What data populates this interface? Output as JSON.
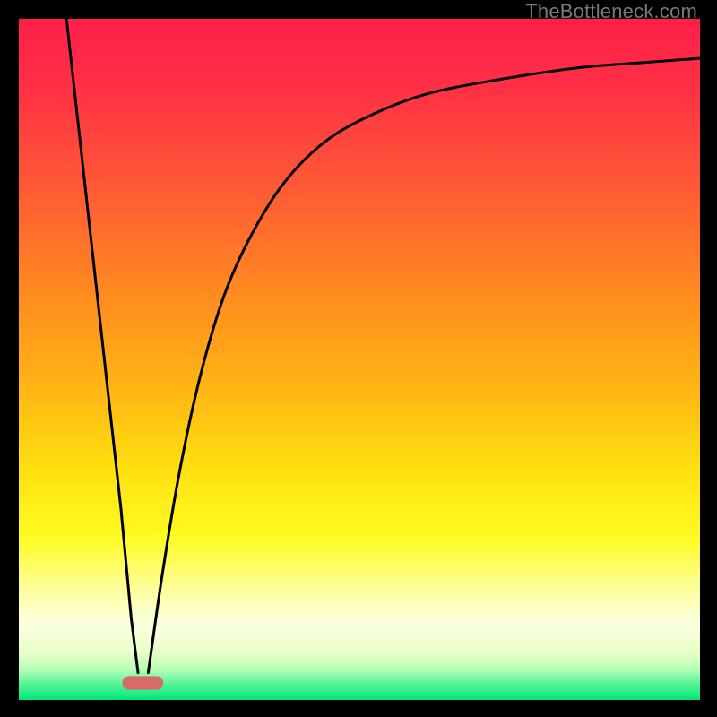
{
  "watermark": {
    "text": "TheBottleneck.com"
  },
  "gradient": {
    "stops": [
      {
        "offset": 0.0,
        "color": "#ff1f4b"
      },
      {
        "offset": 0.1,
        "color": "#ff3045"
      },
      {
        "offset": 0.25,
        "color": "#ff5a35"
      },
      {
        "offset": 0.4,
        "color": "#ff8a20"
      },
      {
        "offset": 0.55,
        "color": "#ffb814"
      },
      {
        "offset": 0.66,
        "color": "#ffe010"
      },
      {
        "offset": 0.76,
        "color": "#fffb22"
      },
      {
        "offset": 0.84,
        "color": "#fdffa0"
      },
      {
        "offset": 0.89,
        "color": "#faffe0"
      },
      {
        "offset": 0.93,
        "color": "#e8ffc6"
      },
      {
        "offset": 0.955,
        "color": "#b6ffb8"
      },
      {
        "offset": 0.975,
        "color": "#5cf598"
      },
      {
        "offset": 1.0,
        "color": "#00e77a"
      }
    ]
  },
  "marker": {
    "cx_frac": 0.182,
    "cy_frac": 0.975,
    "w_frac": 0.06,
    "h_frac": 0.02,
    "fill": "#d96a6a"
  },
  "chart_data": {
    "type": "line",
    "title": "",
    "xlabel": "",
    "ylabel": "",
    "xlim": [
      0,
      1
    ],
    "ylim": [
      0,
      1
    ],
    "legend": false,
    "grid": false,
    "series": [
      {
        "name": "left-branch",
        "x": [
          0.07,
          0.09,
          0.11,
          0.13,
          0.15,
          0.165,
          0.175
        ],
        "values": [
          1.0,
          0.82,
          0.64,
          0.46,
          0.28,
          0.12,
          0.04
        ]
      },
      {
        "name": "right-branch",
        "x": [
          0.19,
          0.21,
          0.235,
          0.265,
          0.3,
          0.34,
          0.39,
          0.45,
          0.52,
          0.6,
          0.7,
          0.82,
          0.92,
          1.0
        ],
        "values": [
          0.04,
          0.18,
          0.33,
          0.47,
          0.59,
          0.68,
          0.76,
          0.82,
          0.86,
          0.89,
          0.91,
          0.928,
          0.936,
          0.942
        ]
      }
    ],
    "annotations": [
      {
        "type": "marker",
        "shape": "pill",
        "x": 0.182,
        "y": 0.025,
        "label": "minimum",
        "color": "#d96a6a"
      }
    ]
  }
}
